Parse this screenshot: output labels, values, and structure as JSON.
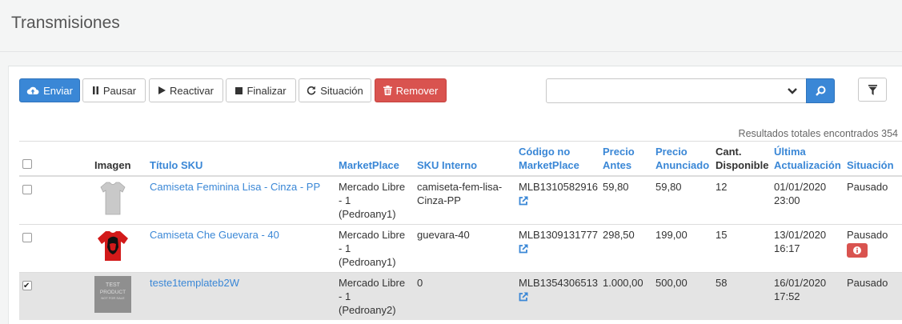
{
  "page": {
    "title": "Transmisiones"
  },
  "toolbar": {
    "send": "Enviar",
    "pause": "Pausar",
    "reactivate": "Reactivar",
    "finish": "Finalizar",
    "status": "Situación",
    "remove": "Remover"
  },
  "search": {
    "value": "",
    "placeholder": ""
  },
  "results_label": "Resultados totales encontrados 354",
  "columns": {
    "image": "Imagen",
    "title": "Título SKU",
    "marketplace": "MarketPlace",
    "sku_internal": "SKU Interno",
    "mkt_code": "Código no MarketPlace",
    "price_before": "Precio Antes",
    "price_listed": "Precio Anunciado",
    "qty": "Cant. Disponible",
    "updated": "Última Actualización",
    "status": "Situación"
  },
  "rows": [
    {
      "checked": false,
      "image": "gray-tshirt",
      "title": "Camiseta Feminina Lisa - Cinza - PP",
      "marketplace": "Mercado Libre - 1 (Pedroany1)",
      "sku_internal": "camiseta-fem-lisa-Cinza-PP",
      "mkt_code": "MLB1310582916",
      "price_before": "59,80",
      "price_listed": "59,80",
      "qty": "12",
      "updated": "01/01/2020 23:00",
      "status": "Pausado",
      "has_info_badge": false
    },
    {
      "checked": false,
      "image": "red-tshirt",
      "title": "Camiseta Che Guevara - 40",
      "marketplace": "Mercado Libre - 1 (Pedroany1)",
      "sku_internal": "guevara-40",
      "mkt_code": "MLB1309131777",
      "price_before": "298,50",
      "price_listed": "199,00",
      "qty": "15",
      "updated": "13/01/2020 16:17",
      "status": "Pausado",
      "has_info_badge": true
    },
    {
      "checked": true,
      "image": "test-product",
      "image_text": [
        "TEST",
        "PRODUCT",
        "NOT FOR SALE"
      ],
      "title": "teste1templateb2W",
      "marketplace": "Mercado Libre - 1 (Pedroany2)",
      "sku_internal": "0",
      "mkt_code": "MLB1354306513",
      "price_before": "1.000,00",
      "price_listed": "500,00",
      "qty": "58",
      "updated": "16/01/2020 17:52",
      "status": "Pausado",
      "has_info_badge": false
    }
  ],
  "icons": {
    "send": "cloud-upload-icon",
    "pause": "pause-icon",
    "reactivate": "play-icon",
    "finish": "stop-icon",
    "status": "refresh-icon",
    "remove": "trash-icon",
    "caret": "chevron-down-icon",
    "search": "search-icon",
    "filter": "filter-icon",
    "external": "external-link-icon",
    "info": "info-icon"
  },
  "colors": {
    "primary": "#3a87d6",
    "danger": "#d9534f",
    "selected_row": "#e4e4e4"
  }
}
